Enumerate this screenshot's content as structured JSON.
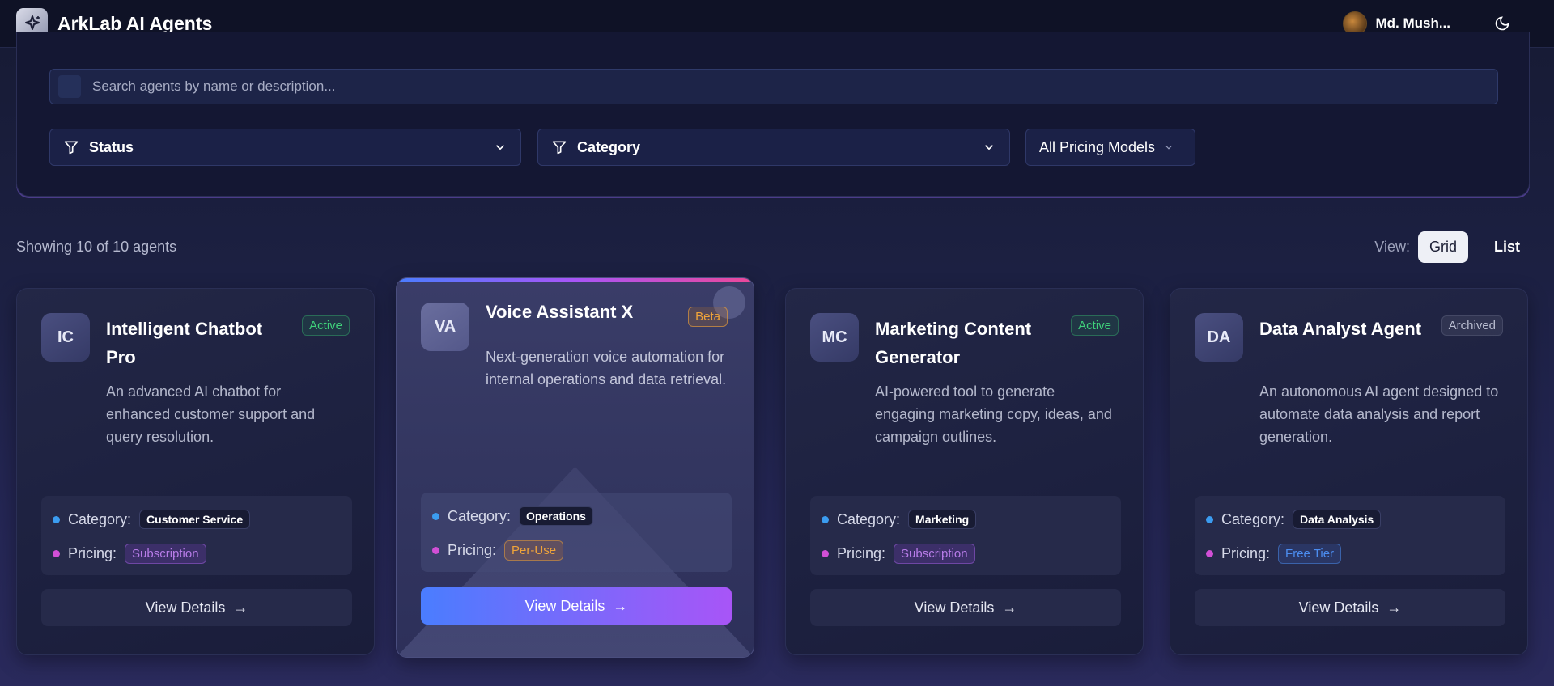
{
  "header": {
    "brand_title": "ArkLab AI Agents",
    "user_name": "Md. Mush...",
    "icons": {
      "logo": "sparkles-icon",
      "theme": "moon-icon"
    }
  },
  "filters": {
    "search_placeholder": "Search agents by name or description...",
    "status_label": "Status",
    "category_label": "Category",
    "pricing_label": "All Pricing Models"
  },
  "results": {
    "summary": "Showing 10 of 10 agents",
    "view_label": "View:",
    "grid_label": "Grid",
    "list_label": "List"
  },
  "labels": {
    "category": "Category:",
    "pricing": "Pricing:",
    "view_details": "View Details",
    "arrow": "→"
  },
  "agents": [
    {
      "initials": "IC",
      "name": "Intelligent Chatbot Pro",
      "status": "Active",
      "description": "An advanced AI chatbot for enhanced customer support and query resolution.",
      "category": "Customer Service",
      "pricing": "Subscription"
    },
    {
      "initials": "VA",
      "name": "Voice Assistant X",
      "status": "Beta",
      "description": "Next-generation voice automation for internal operations and data retrieval.",
      "category": "Operations",
      "pricing": "Per-Use"
    },
    {
      "initials": "MC",
      "name": "Marketing Content Generator",
      "status": "Active",
      "description": "AI-powered tool to generate engaging marketing copy, ideas, and campaign outlines.",
      "category": "Marketing",
      "pricing": "Subscription"
    },
    {
      "initials": "DA",
      "name": "Data Analyst Agent",
      "status": "Archived",
      "description": "An autonomous AI agent designed to automate data analysis and report generation.",
      "category": "Data Analysis",
      "pricing": "Free Tier"
    }
  ],
  "colors": {
    "active": "#3fd07a",
    "beta": "#f0a43a",
    "archived": "#b9bdd0",
    "subscription": "#b77ce8",
    "per_use": "#f0a43a",
    "free_tier": "#4c8df0",
    "accent_gradient_start": "#4a7dff",
    "accent_gradient_end": "#a855f7"
  }
}
